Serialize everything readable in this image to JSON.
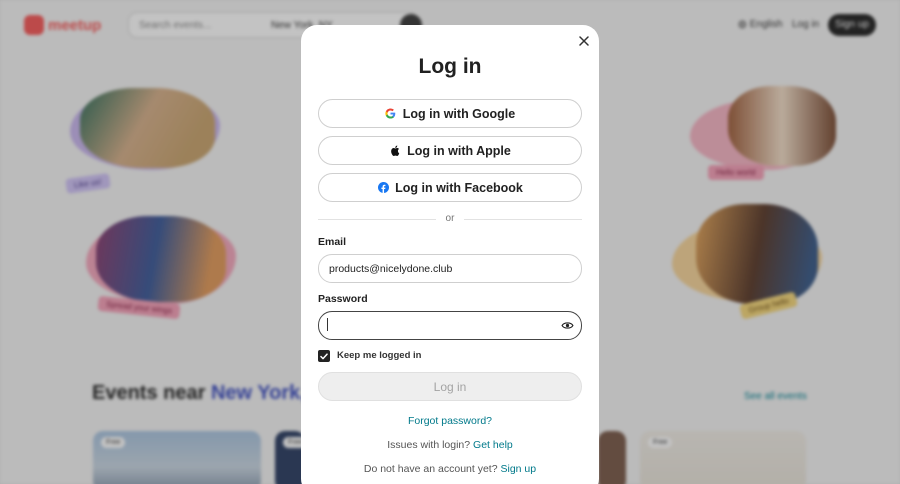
{
  "background": {
    "logo_text": "meetup",
    "search": {
      "placeholder": "Search events...",
      "location": "New York, NY"
    },
    "header": {
      "language": "English",
      "login": "Log in",
      "signup": "Sign up"
    },
    "stickers": [
      "Like us!",
      "Spread your wings",
      "Hello world",
      "Group hello"
    ],
    "events": {
      "title_prefix": "Events near",
      "title_city": "New York, NY",
      "see_all": "See all events"
    },
    "card_tag": "Free"
  },
  "modal": {
    "title": "Log in",
    "social": {
      "google": "Log in with Google",
      "apple": "Log in with Apple",
      "facebook": "Log in with Facebook"
    },
    "divider_text": "or",
    "email": {
      "label": "Email",
      "value": "products@nicelydone.club"
    },
    "password": {
      "label": "Password",
      "value": ""
    },
    "keep_logged_in": {
      "label": "Keep me logged in",
      "checked": true
    },
    "submit_label": "Log in",
    "forgot_password": "Forgot password?",
    "issues": {
      "text": "Issues with login?",
      "link": "Get help"
    },
    "no_account": {
      "text": "Do not have an account yet?",
      "link": "Sign up"
    }
  },
  "colors": {
    "brand": "#f65858",
    "link": "#00798a",
    "facebook": "#1877f2",
    "google_blue": "#4285f4"
  }
}
